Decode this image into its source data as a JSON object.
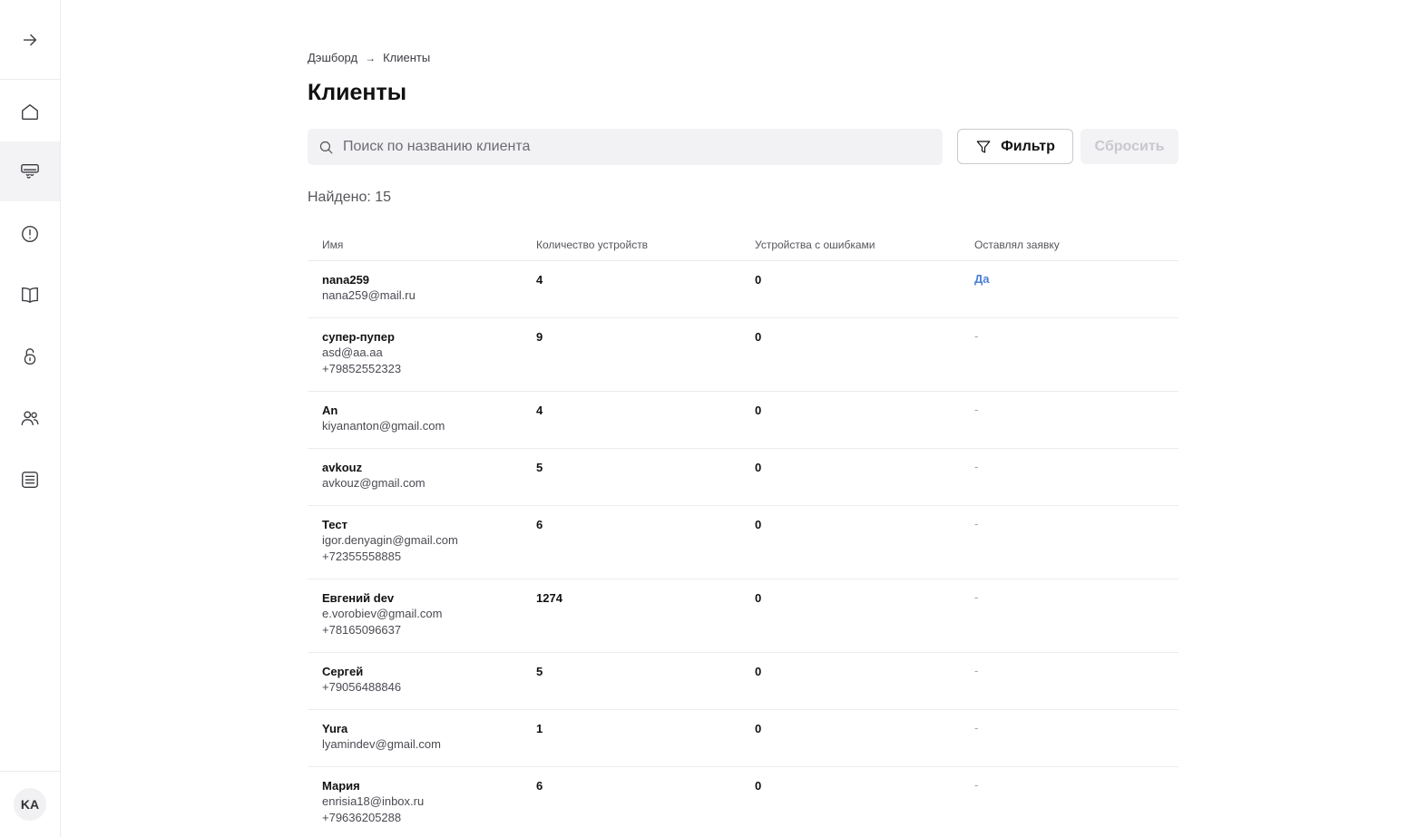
{
  "sidebar": {
    "toggle_icon": "arrow-right-icon",
    "items": [
      {
        "icon": "home-icon"
      },
      {
        "icon": "air-conditioner-icon",
        "active": true
      },
      {
        "icon": "alert-circle-icon"
      },
      {
        "icon": "book-icon"
      },
      {
        "icon": "lock-icon"
      },
      {
        "icon": "users-icon"
      },
      {
        "icon": "list-icon"
      }
    ],
    "avatar_initials": "KA"
  },
  "breadcrumb": {
    "items": [
      "Дэшборд",
      "Клиенты"
    ]
  },
  "page_title": "Клиенты",
  "search": {
    "placeholder": "Поиск по названию клиента",
    "value": ""
  },
  "actions": {
    "filter_label": "Фильтр",
    "reset_label": "Сбросить"
  },
  "found_text": "Найдено: 15",
  "table": {
    "headers": [
      "Имя",
      "Количество устройств",
      "Устройства с ошибками",
      "Оставлял заявку"
    ],
    "rows": [
      {
        "name": "nana259",
        "lines": [
          "nana259@mail.ru"
        ],
        "devices": "4",
        "errors": "0",
        "request": "Да"
      },
      {
        "name": "супер-пупер",
        "lines": [
          "asd@aa.aa",
          "+79852552323"
        ],
        "devices": "9",
        "errors": "0",
        "request": "-"
      },
      {
        "name": "An",
        "lines": [
          "kiyananton@gmail.com"
        ],
        "devices": "4",
        "errors": "0",
        "request": "-"
      },
      {
        "name": "avkouz",
        "lines": [
          "avkouz@gmail.com"
        ],
        "devices": "5",
        "errors": "0",
        "request": "-"
      },
      {
        "name": "Тест",
        "lines": [
          "igor.denyagin@gmail.com",
          "+72355558885"
        ],
        "devices": "6",
        "errors": "0",
        "request": "-"
      },
      {
        "name": "Евгений dev",
        "lines": [
          "e.vorobiev@gmail.com",
          "+78165096637"
        ],
        "devices": "1274",
        "errors": "0",
        "request": "-"
      },
      {
        "name": "Сергей",
        "lines": [
          "+79056488846"
        ],
        "devices": "5",
        "errors": "0",
        "request": "-"
      },
      {
        "name": "Yura",
        "lines": [
          "lyamindev@gmail.com"
        ],
        "devices": "1",
        "errors": "0",
        "request": "-"
      },
      {
        "name": "Мария",
        "lines": [
          "enrisia18@inbox.ru",
          "+79636205288"
        ],
        "devices": "6",
        "errors": "0",
        "request": "-"
      }
    ]
  }
}
